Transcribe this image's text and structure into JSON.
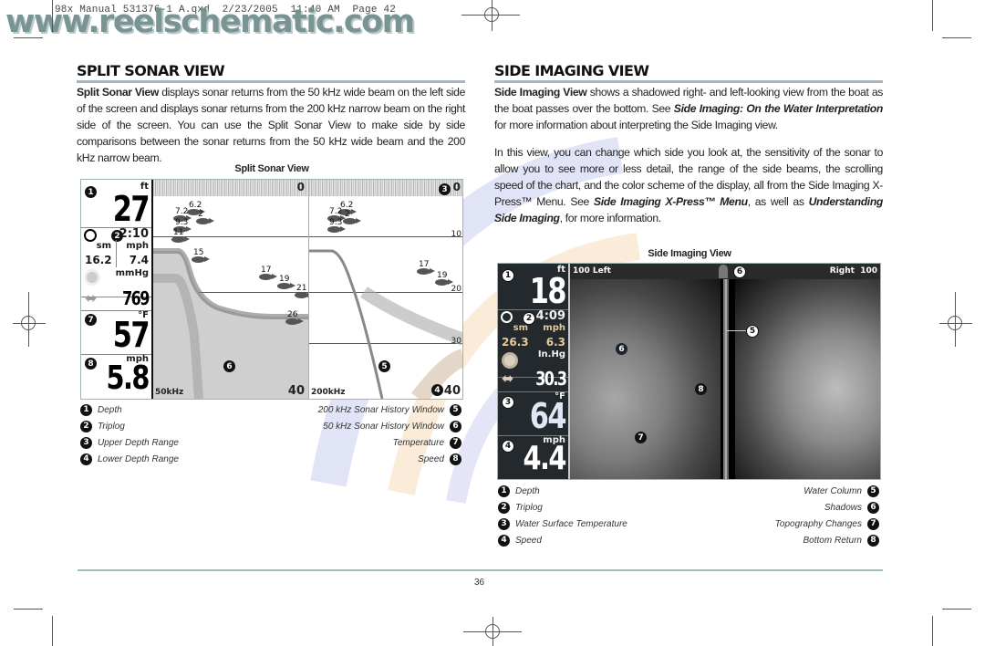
{
  "print_slug": "98x Manual 531376-1 A.qxd  2/23/2005  11:40 AM  Page 42",
  "watermark": "www.reelschematic.com",
  "page_number": "36",
  "colors": {
    "heading_rule": "#a9b4be",
    "footer_rule": "#9fbcbc",
    "screen_border": "#9fb3b3",
    "watermark": "#6f8c8c"
  },
  "split_sonar": {
    "heading": "SPLIT SONAR VIEW",
    "intro_bold": "Split Sonar View",
    "intro_rest": " displays sonar returns from the 50 kHz wide beam on the left side of the screen and displays sonar returns from the 200 kHz narrow beam on the right side of the screen. You can use the Split Sonar View to make side by side comparisons between the sonar returns from the 50 kHz wide beam and the 200 kHz narrow beam.",
    "caption": "Split Sonar View",
    "screen": {
      "depth_unit": "ft",
      "depth_value": "27",
      "triplog_time": "2:10",
      "distance_unit": "sm",
      "speed_unit_small": "mph",
      "distance_value": "16.2",
      "speed_value_small": "7.4",
      "pressure_unit": "mmHg",
      "pressure_value": "769",
      "temp_unit": "°F",
      "temp_value": "57",
      "speed_unit": "mph",
      "speed_value": "5.8",
      "left_freq": "50kHz",
      "right_freq": "200kHz",
      "left_top_depth": "0",
      "left_bottom_depth": "40",
      "right_top_depth": "0",
      "right_bottom_depth": "40",
      "depth_ticks": [
        "10",
        "20",
        "30"
      ],
      "fish_left": [
        "6.2",
        "7.2",
        "2",
        "9.3",
        "11",
        "15",
        "17",
        "19",
        "21",
        "26"
      ],
      "fish_right": [
        "6.2",
        "7.2",
        "2",
        "9.3",
        "17",
        "19"
      ],
      "callouts": [
        "1",
        "2",
        "3",
        "4",
        "5",
        "6",
        "7",
        "8"
      ]
    },
    "legend_left": [
      {
        "num": "1",
        "label": "Depth"
      },
      {
        "num": "2",
        "label": "Triplog"
      },
      {
        "num": "3",
        "label": "Upper Depth Range"
      },
      {
        "num": "4",
        "label": "Lower Depth Range"
      }
    ],
    "legend_right": [
      {
        "num": "5",
        "label": "200 kHz Sonar History Window"
      },
      {
        "num": "6",
        "label": "50 kHz Sonar History Window"
      },
      {
        "num": "7",
        "label": "Temperature"
      },
      {
        "num": "8",
        "label": "Speed"
      }
    ]
  },
  "side_imaging": {
    "heading": "SIDE IMAGING VIEW",
    "intro_bold": "Side Imaging View",
    "intro_rest_1": " shows a shadowed right- and left-looking view from the boat as the boat passes over the bottom. See ",
    "intro_ref": "Side Imaging: On the Water Interpretation",
    "intro_rest_2": " for more information about interpreting the Side Imaging view.",
    "para2_1": "In this view, you can change which side you look at, the sensitivity of the sonar to allow you to see more or less detail, the range of the side beams, the scrolling speed of the chart, and the color scheme of the display, all from the Side Imaging X-Press™ Menu. See ",
    "para2_ref1": "Side Imaging X-Press™ Menu",
    "para2_mid": ", as well as ",
    "para2_ref2": "Understanding Side Imaging",
    "para2_end": ", for more information.",
    "caption": "Side Imaging View",
    "screen": {
      "depth_unit": "ft",
      "depth_value": "18",
      "range_left": "100 Left",
      "range_right": "Right  100",
      "triplog_time": "4:09",
      "distance_unit": "sm",
      "speed_unit_small": "mph",
      "distance_value": "26.3",
      "speed_value_small": "6.3",
      "pressure_unit": "In.Hg",
      "pressure_value": "30.3",
      "temp_unit": "°F",
      "temp_value": "64",
      "speed_unit": "mph",
      "speed_value": "4.4",
      "callouts": [
        "1",
        "2",
        "3",
        "4",
        "5",
        "6",
        "7",
        "8"
      ]
    },
    "legend_left": [
      {
        "num": "1",
        "label": "Depth"
      },
      {
        "num": "2",
        "label": "Triplog"
      },
      {
        "num": "3",
        "label": "Water Surface Temperature"
      },
      {
        "num": "4",
        "label": "Speed"
      }
    ],
    "legend_right": [
      {
        "num": "5",
        "label": "Water Column"
      },
      {
        "num": "6",
        "label": "Shadows"
      },
      {
        "num": "7",
        "label": "Topography Changes"
      },
      {
        "num": "8",
        "label": "Bottom Return"
      }
    ]
  }
}
